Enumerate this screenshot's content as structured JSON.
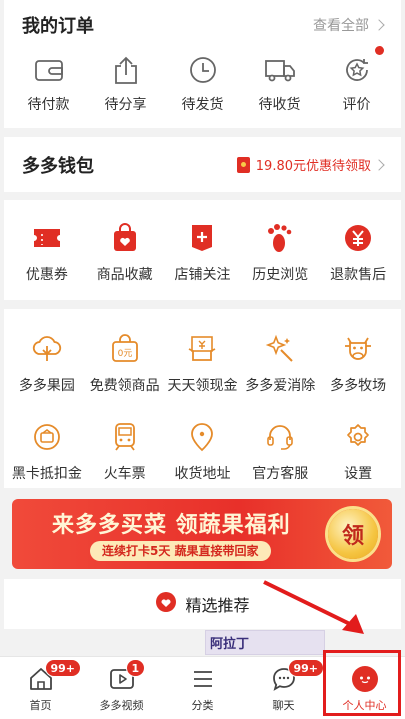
{
  "orders": {
    "title": "我的订单",
    "view_all": "查看全部",
    "items": [
      {
        "label": "待付款",
        "icon": "wallet-icon"
      },
      {
        "label": "待分享",
        "icon": "share-icon"
      },
      {
        "label": "待发货",
        "icon": "clock-icon"
      },
      {
        "label": "待收货",
        "icon": "truck-icon"
      },
      {
        "label": "评价",
        "icon": "review-icon"
      }
    ]
  },
  "wallet": {
    "title": "多多钱包",
    "promo": "19.80元优惠待领取"
  },
  "shortcuts": [
    {
      "label": "优惠券",
      "icon": "coupon-icon"
    },
    {
      "label": "商品收藏",
      "icon": "bag-heart-icon"
    },
    {
      "label": "店铺关注",
      "icon": "shop-plus-icon"
    },
    {
      "label": "历史浏览",
      "icon": "footprint-icon"
    },
    {
      "label": "退款售后",
      "icon": "refund-icon"
    }
  ],
  "services": {
    "row1": [
      {
        "label": "多多果园",
        "icon": "tree-icon"
      },
      {
        "label": "免费领商品",
        "icon": "free-bag-icon"
      },
      {
        "label": "天天领现金",
        "icon": "cash-icon"
      },
      {
        "label": "多多爱消除",
        "icon": "sparkle-icon"
      },
      {
        "label": "多多牧场",
        "icon": "cow-icon"
      }
    ],
    "row2": [
      {
        "label": "黑卡抵扣金",
        "icon": "card-icon"
      },
      {
        "label": "火车票",
        "icon": "train-icon"
      },
      {
        "label": "收货地址",
        "icon": "location-icon"
      },
      {
        "label": "官方客服",
        "icon": "headset-icon"
      },
      {
        "label": "设置",
        "icon": "gear-icon"
      }
    ],
    "row2_text": {
      "card_mini": "0元"
    }
  },
  "banner": {
    "title": "来多多买菜 领蔬果福利",
    "subtitle": "连续打卡5天 蔬果直接带回家",
    "coin": "领"
  },
  "recommend": {
    "label": "精选推荐"
  },
  "thumb": {
    "text": "阿拉丁"
  },
  "tabs": [
    {
      "label": "首页",
      "badge": "99+",
      "icon": "home-icon"
    },
    {
      "label": "多多视频",
      "badge": "1",
      "icon": "video-icon"
    },
    {
      "label": "分类",
      "badge": "",
      "icon": "list-icon"
    },
    {
      "label": "聊天",
      "badge": "99+",
      "icon": "chat-icon"
    },
    {
      "label": "个人中心",
      "badge": "",
      "icon": "profile-icon"
    }
  ],
  "colors": {
    "accent": "#e02e24",
    "service_orange": "#e58b2a",
    "icon_gray": "#666666"
  }
}
